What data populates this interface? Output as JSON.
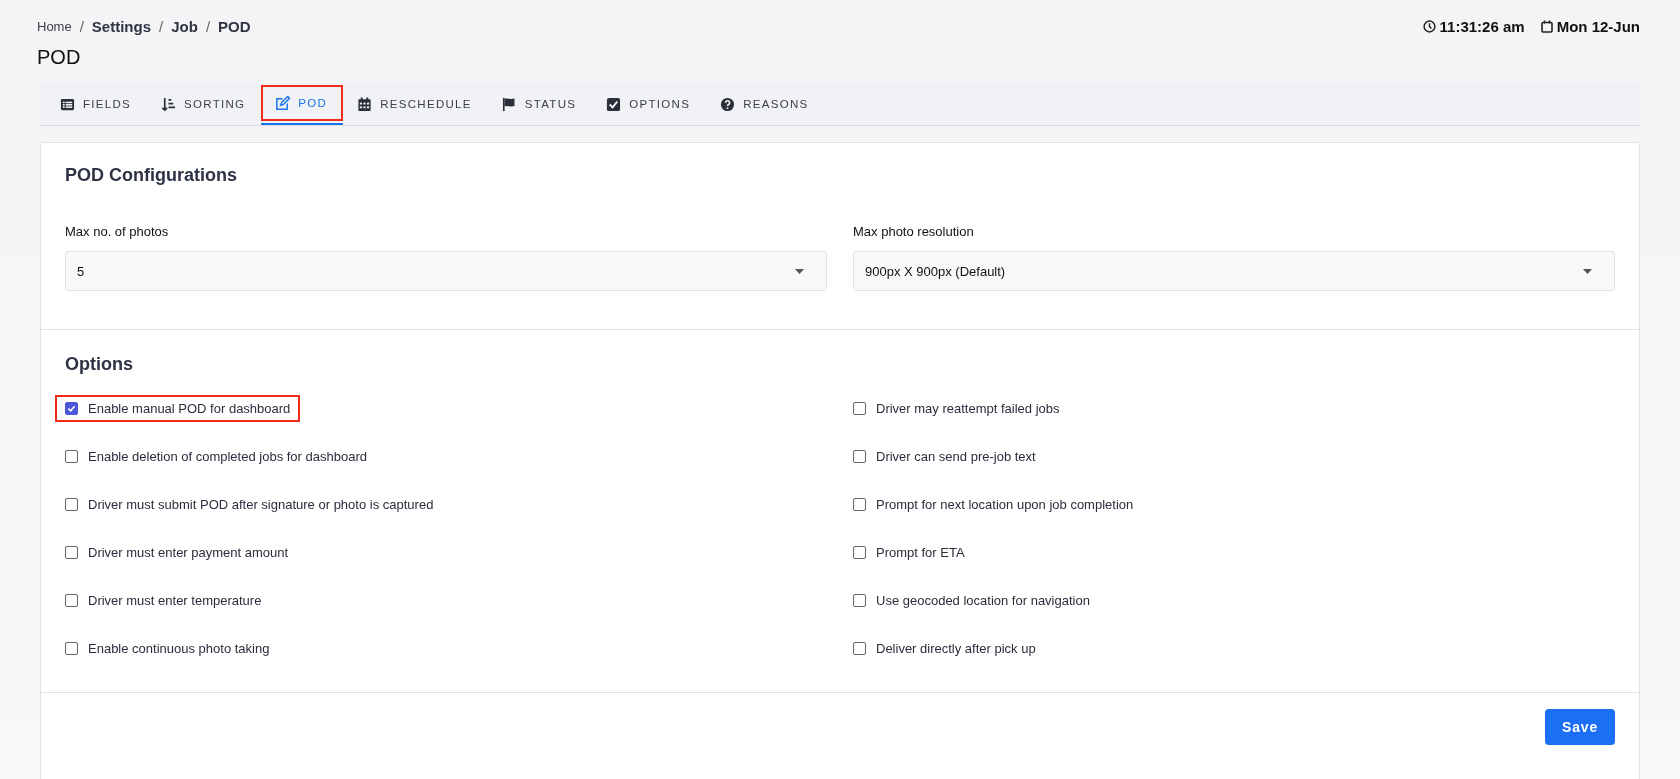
{
  "breadcrumb": [
    {
      "kind": "link",
      "label": "Home",
      "bold": false
    },
    {
      "kind": "separator",
      "label": "/"
    },
    {
      "kind": "link",
      "label": "Settings",
      "bold": true
    },
    {
      "kind": "separator",
      "label": "/"
    },
    {
      "kind": "link",
      "label": "Job",
      "bold": true
    },
    {
      "kind": "separator",
      "label": "/"
    },
    {
      "kind": "link",
      "label": "POD",
      "bold": true
    }
  ],
  "clock": {
    "time": "11:31:26 am",
    "date": "Mon 12-Jun"
  },
  "page_title": "POD",
  "tabs": [
    {
      "label": "FIELDS",
      "selected": false,
      "highlighted": false
    },
    {
      "label": "SORTING",
      "selected": false,
      "highlighted": false
    },
    {
      "label": "POD",
      "selected": true,
      "highlighted": true
    },
    {
      "label": "RESCHEDULE",
      "selected": false,
      "highlighted": false
    },
    {
      "label": "STATUS",
      "selected": false,
      "highlighted": false
    },
    {
      "label": "OPTIONS",
      "selected": false,
      "highlighted": false
    },
    {
      "label": "REASONS",
      "selected": false,
      "highlighted": false
    }
  ],
  "configurations": {
    "title": "POD Configurations",
    "fields": [
      {
        "label": "Max no. of photos",
        "value": "5"
      },
      {
        "label": "Max photo resolution",
        "value": "900px X 900px (Default)"
      }
    ]
  },
  "options": {
    "title": "Options",
    "columns": [
      [
        {
          "label": "Enable manual POD for dashboard",
          "checked": true,
          "highlighted": true
        },
        {
          "label": "Enable deletion of completed jobs for dashboard",
          "checked": false,
          "highlighted": false
        },
        {
          "label": "Driver must submit POD after signature or photo is captured",
          "checked": false,
          "highlighted": false
        },
        {
          "label": "Driver must enter payment amount",
          "checked": false,
          "highlighted": false
        },
        {
          "label": "Driver must enter temperature",
          "checked": false,
          "highlighted": false
        },
        {
          "label": "Enable continuous photo taking",
          "checked": false,
          "highlighted": false
        }
      ],
      [
        {
          "label": "Driver may reattempt failed jobs",
          "checked": false,
          "highlighted": false
        },
        {
          "label": "Driver can send pre-job text",
          "checked": false,
          "highlighted": false
        },
        {
          "label": "Prompt for next location upon job completion",
          "checked": false,
          "highlighted": false
        },
        {
          "label": "Prompt for ETA",
          "checked": false,
          "highlighted": false
        },
        {
          "label": "Use geocoded location for navigation",
          "checked": false,
          "highlighted": false
        },
        {
          "label": "Deliver directly after pick up",
          "checked": false,
          "highlighted": false
        }
      ]
    ]
  },
  "save_button": "Save"
}
